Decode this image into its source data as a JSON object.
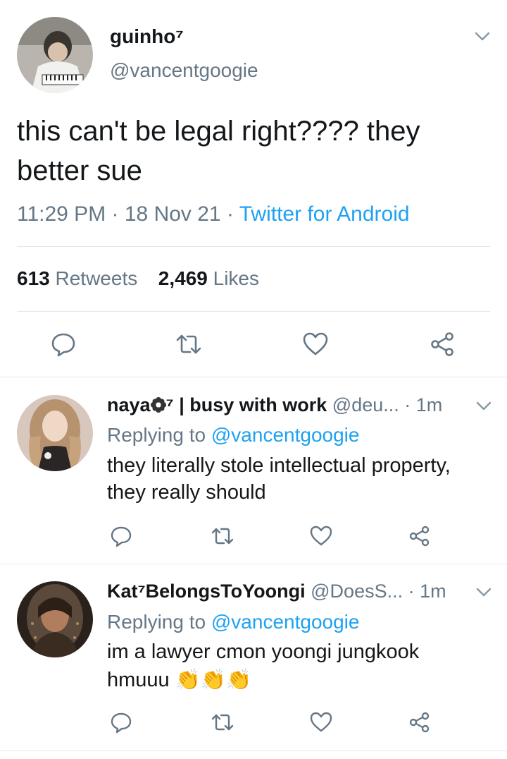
{
  "main_tweet": {
    "display_name": "guinho⁷",
    "handle": "@vancentgoogie",
    "text_line1": "this can't be legal right???? they",
    "text_line2": "better sue",
    "time": "11:29 PM",
    "date": "18 Nov 21",
    "source": "Twitter for Android",
    "retweets_count": "613",
    "retweets_label": "Retweets",
    "likes_count": "2,469",
    "likes_label": "Likes"
  },
  "replies": [
    {
      "display_name": "naya",
      "name_suffix": "⁷ | busy with work",
      "handle": "@deu...",
      "time": "· 1m",
      "replying_prefix": "Replying to",
      "replying_to": "@vancentgoogie",
      "text_line1": "they literally stole intellectual property,",
      "text_line2": "they really should"
    },
    {
      "display_name": "Kat⁷BelongsToYoongi",
      "handle": "@DoesS...",
      "time": "· 1m",
      "replying_prefix": "Replying to",
      "replying_to": "@vancentgoogie",
      "text_line1": "im a lawyer cmon yoongi jungkook",
      "text_line2": "hmuuu",
      "emoji": "👏👏👏"
    }
  ],
  "icons": [
    "chevron-down-icon",
    "reply-icon",
    "retweet-icon",
    "like-icon",
    "share-icon"
  ],
  "colors": {
    "accent": "#1da1f2",
    "muted": "#657786",
    "divider": "#e1e8ed"
  }
}
